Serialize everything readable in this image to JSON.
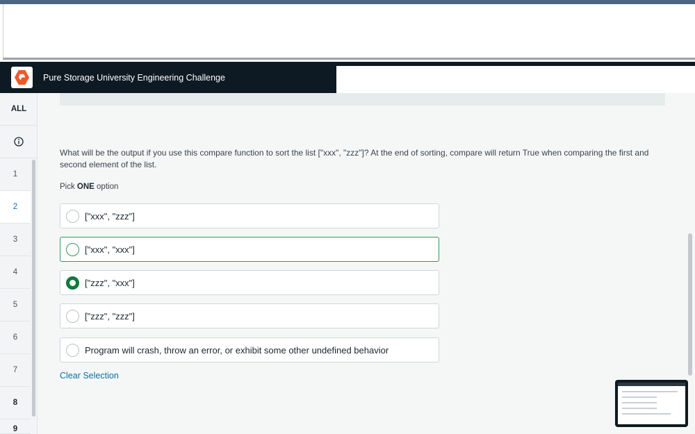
{
  "header": {
    "title": "Pure Storage University Engineering Challenge",
    "logo_color": "#f0582b"
  },
  "sidebar": {
    "all_label": "ALL",
    "info_icon": "info-icon",
    "items": [
      "1",
      "2",
      "3",
      "4",
      "5",
      "6",
      "7",
      "8",
      "9"
    ],
    "active_item": "2"
  },
  "question": {
    "text": "What will be the output if you use this compare function to sort the list [\"xxx\", \"zzz\"]? At the end of sorting, compare will return True when comparing the first and second element of the list.",
    "pick_prefix": "Pick ",
    "pick_bold": "ONE",
    "pick_suffix": " option"
  },
  "options": [
    {
      "label": "[\"xxx\", \"zzz\"]",
      "selected": false
    },
    {
      "label": "[\"xxx\", \"xxx\"]",
      "selected": false
    },
    {
      "label": "[\"zzz\", \"xxx\"]",
      "selected": true
    },
    {
      "label": "[\"zzz\", \"zzz\"]",
      "selected": false
    },
    {
      "label": "Program will crash, throw an error, or exhibit some other undefined behavior",
      "selected": false
    }
  ],
  "clear_selection": "Clear Selection",
  "colors": {
    "header_bg": "#0e1a23",
    "accent": "#0b6ea8",
    "selected": "#0e7a3c",
    "hover_border": "#2f9a5a"
  }
}
